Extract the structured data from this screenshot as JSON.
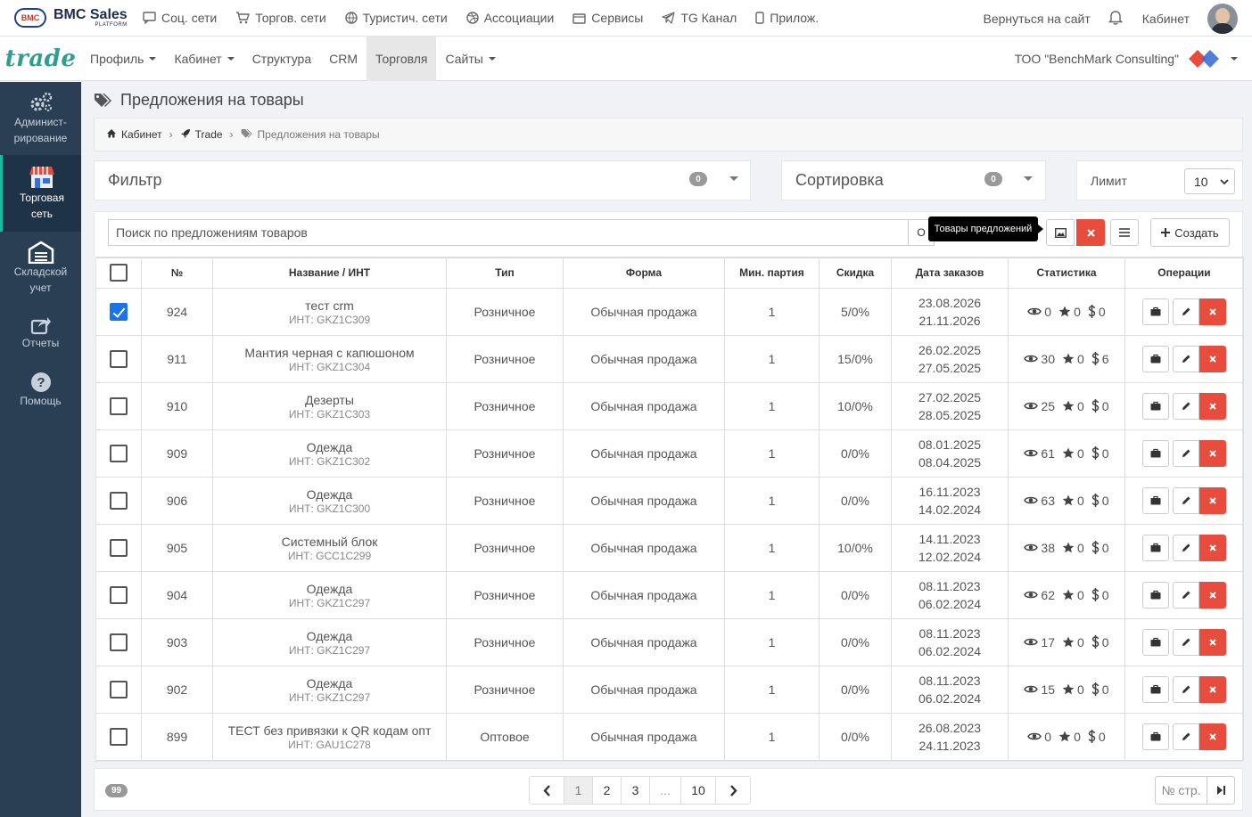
{
  "top": {
    "logo": {
      "line1": "BMC Sales",
      "line2": "PLATFORM",
      "mark": "BMC"
    },
    "links": [
      {
        "label": "Соц. сети",
        "icon": "chat-icon"
      },
      {
        "label": "Торгов. сети",
        "icon": "cart-icon"
      },
      {
        "label": "Туристич. сети",
        "icon": "globe-icon"
      },
      {
        "label": "Ассоциации",
        "icon": "dribbble-icon"
      },
      {
        "label": "Сервисы",
        "icon": "box-icon"
      },
      {
        "label": "TG Канал",
        "icon": "telegram-icon"
      },
      {
        "label": "Прилож.",
        "icon": "phone-icon"
      }
    ],
    "back_to_site": "Вернуться на сайт",
    "cabinet": "Кабинет"
  },
  "nav": {
    "brand": "trade",
    "menu": [
      {
        "label": "Профиль",
        "dropdown": true
      },
      {
        "label": "Кабинет",
        "dropdown": true
      },
      {
        "label": "Структура",
        "dropdown": false
      },
      {
        "label": "CRM",
        "dropdown": false
      },
      {
        "label": "Торговля",
        "dropdown": false,
        "active": true
      },
      {
        "label": "Сайты",
        "dropdown": true
      }
    ],
    "company": "ТОО \"BenchMark Consulting\""
  },
  "sidebar": [
    {
      "label": "Админист-рование",
      "line1": "Админист-",
      "line2": "рирование",
      "icon": "gears-icon"
    },
    {
      "label": "Торговая сеть",
      "line1": "Торговая",
      "line2": "сеть",
      "icon": "store-icon",
      "active": true
    },
    {
      "label": "Складской учет",
      "line1": "Складской",
      "line2": "учет",
      "icon": "warehouse-icon"
    },
    {
      "label": "Отчеты",
      "line1": "Отчеты",
      "line2": "",
      "icon": "share-icon"
    },
    {
      "label": "Помощь",
      "line1": "Помощь",
      "line2": "",
      "icon": "question-icon"
    }
  ],
  "page": {
    "title": "Предложения на товары",
    "breadcrumb": [
      "Кабинет",
      "Trade",
      "Предложения на товары"
    ]
  },
  "filter": {
    "title": "Фильтр",
    "count": "0"
  },
  "sort": {
    "title": "Сортировка",
    "count": "0"
  },
  "limit": {
    "label": "Лимит",
    "value": "10"
  },
  "toolbar": {
    "search_placeholder": "Поиск по предложениям товаров",
    "search_button": "О",
    "tooltip": "Товары предложений",
    "create": "Создать"
  },
  "table": {
    "headers": [
      "№",
      "Название / ИНТ",
      "Тип",
      "Форма",
      "Мин. партия",
      "Скидка",
      "Дата заказов",
      "Статистика",
      "Операции"
    ],
    "rows": [
      {
        "checked": true,
        "id": "924",
        "name": "тест crm",
        "inn": "ИНТ: GKZ1C309",
        "type": "Розничное",
        "form": "Обычная продажа",
        "min": "1",
        "discount": "5/0%",
        "d1": "23.08.2026",
        "d2": "21.11.2026",
        "views": "0",
        "stars": "0",
        "money": "0"
      },
      {
        "checked": false,
        "id": "911",
        "name": "Мантия черная с капюшоном",
        "inn": "ИНТ: GKZ1C304",
        "type": "Розничное",
        "form": "Обычная продажа",
        "min": "1",
        "discount": "15/0%",
        "d1": "26.02.2025",
        "d2": "27.05.2025",
        "views": "30",
        "stars": "0",
        "money": "6"
      },
      {
        "checked": false,
        "id": "910",
        "name": "Дезерты",
        "inn": "ИНТ: GKZ1C303",
        "type": "Розничное",
        "form": "Обычная продажа",
        "min": "1",
        "discount": "10/0%",
        "d1": "27.02.2025",
        "d2": "28.05.2025",
        "views": "25",
        "stars": "0",
        "money": "0"
      },
      {
        "checked": false,
        "id": "909",
        "name": "Одежда",
        "inn": "ИНТ: GKZ1C302",
        "type": "Розничное",
        "form": "Обычная продажа",
        "min": "1",
        "discount": "0/0%",
        "d1": "08.01.2025",
        "d2": "08.04.2025",
        "views": "61",
        "stars": "0",
        "money": "0"
      },
      {
        "checked": false,
        "id": "906",
        "name": "Одежда",
        "inn": "ИНТ: GKZ1C300",
        "type": "Розничное",
        "form": "Обычная продажа",
        "min": "1",
        "discount": "0/0%",
        "d1": "16.11.2023",
        "d2": "14.02.2024",
        "views": "63",
        "stars": "0",
        "money": "0"
      },
      {
        "checked": false,
        "id": "905",
        "name": "Системный блок",
        "inn": "ИНТ: GCC1C299",
        "type": "Розничное",
        "form": "Обычная продажа",
        "min": "1",
        "discount": "10/0%",
        "d1": "14.11.2023",
        "d2": "12.02.2024",
        "views": "38",
        "stars": "0",
        "money": "0"
      },
      {
        "checked": false,
        "id": "904",
        "name": "Одежда",
        "inn": "ИНТ: GKZ1C297",
        "type": "Розничное",
        "form": "Обычная продажа",
        "min": "1",
        "discount": "0/0%",
        "d1": "08.11.2023",
        "d2": "06.02.2024",
        "views": "62",
        "stars": "0",
        "money": "0"
      },
      {
        "checked": false,
        "id": "903",
        "name": "Одежда",
        "inn": "ИНТ: GKZ1C297",
        "type": "Розничное",
        "form": "Обычная продажа",
        "min": "1",
        "discount": "0/0%",
        "d1": "08.11.2023",
        "d2": "06.02.2024",
        "views": "17",
        "stars": "0",
        "money": "0"
      },
      {
        "checked": false,
        "id": "902",
        "name": "Одежда",
        "inn": "ИНТ: GKZ1C297",
        "type": "Розничное",
        "form": "Обычная продажа",
        "min": "1",
        "discount": "0/0%",
        "d1": "08.11.2023",
        "d2": "06.02.2024",
        "views": "15",
        "stars": "0",
        "money": "0"
      },
      {
        "checked": false,
        "id": "899",
        "name": "ТЕСТ без привязки к QR кодам опт",
        "inn": "ИНТ: GAU1C278",
        "type": "Оптовое",
        "form": "Обычная продажа",
        "min": "1",
        "discount": "0/0%",
        "d1": "26.08.2023",
        "d2": "24.11.2023",
        "views": "0",
        "stars": "0",
        "money": "0"
      }
    ]
  },
  "footer": {
    "total": "99",
    "pages": [
      "1",
      "2",
      "3",
      "...",
      "10"
    ],
    "current_page": "1",
    "page_input_placeholder": "№ стр."
  },
  "colors": {
    "accent": "#1abb9c",
    "sidebar": "#2a3f54",
    "danger": "#e74c3c",
    "brand": "#2e9e8f"
  }
}
